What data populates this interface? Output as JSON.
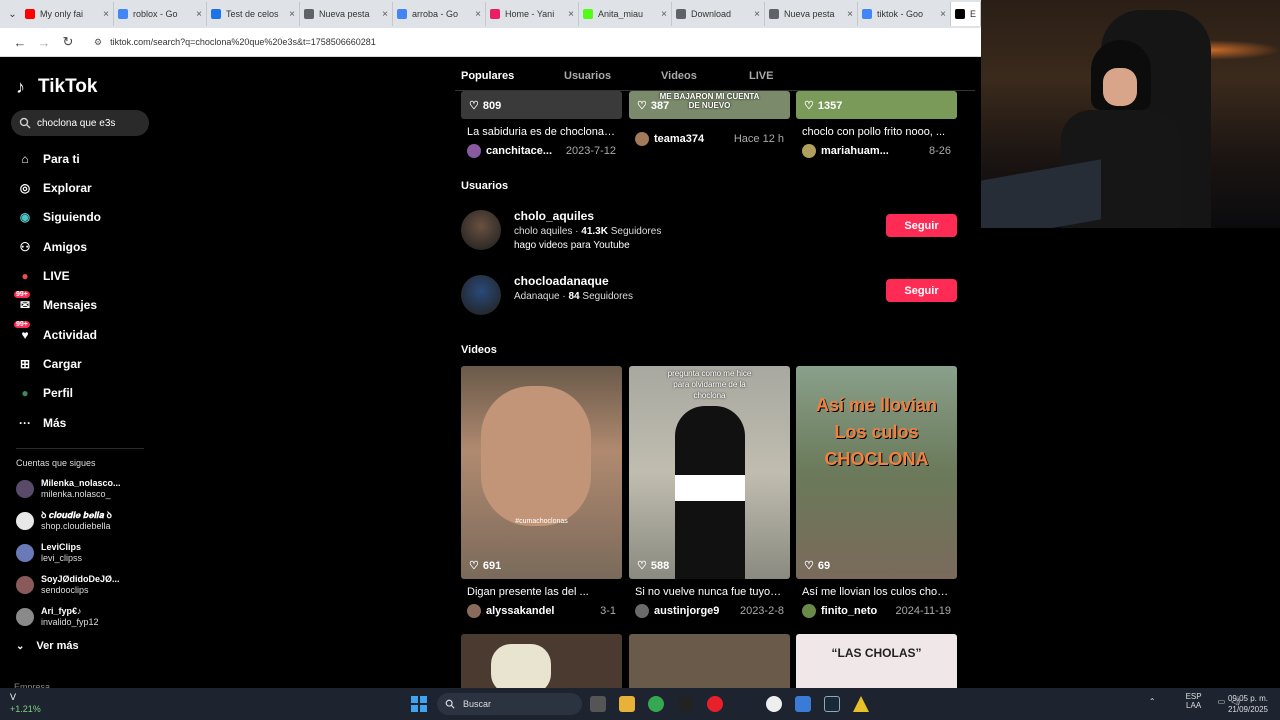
{
  "browser": {
    "tabs": [
      {
        "title": "My only fai",
        "color": "#ff0000"
      },
      {
        "title": "roblox - Go",
        "color": "#4285f4"
      },
      {
        "title": "Test de celos",
        "color": "#1a73e8"
      },
      {
        "title": "Nueva pesta",
        "color": "#5f6368"
      },
      {
        "title": "arroba - Go",
        "color": "#4285f4"
      },
      {
        "title": "Home - Yani",
        "color": "#e91e63"
      },
      {
        "title": "Anita_miau",
        "color": "#53fc18"
      },
      {
        "title": "Download",
        "color": "#5f6368"
      },
      {
        "title": "Nueva pesta",
        "color": "#5f6368"
      },
      {
        "title": "tiktok - Goo",
        "color": "#4285f4"
      },
      {
        "title": "En",
        "color": "#000000"
      }
    ],
    "url": "tiktok.com/search?q=choclona%20que%20e3s&t=1758506660281"
  },
  "sidebar": {
    "logo": "TikTok",
    "search_value": "choclona que e3s",
    "nav": [
      {
        "label": "Para ti",
        "icon": "home-icon"
      },
      {
        "label": "Explorar",
        "icon": "compass-icon"
      },
      {
        "label": "Siguiendo",
        "icon": "following-icon"
      },
      {
        "label": "Amigos",
        "icon": "friends-icon"
      },
      {
        "label": "LIVE",
        "icon": "live-icon"
      },
      {
        "label": "Mensajes",
        "icon": "messages-icon",
        "badge": "99+"
      },
      {
        "label": "Actividad",
        "icon": "activity-icon",
        "badge": "99+"
      },
      {
        "label": "Cargar",
        "icon": "upload-icon"
      },
      {
        "label": "Perfil",
        "icon": "profile-icon"
      },
      {
        "label": "Más",
        "icon": "more-icon"
      }
    ],
    "following_title": "Cuentas que sigues",
    "following": [
      {
        "name": "Milenka_nolasco...",
        "handle": "milenka.nolasco_",
        "color": "#5a4a6a"
      },
      {
        "name": "ꝺ 𝒄𝒍𝒐𝒖𝒅𝒊𝒆 𝒃𝒆𝒍𝒍𝒂 ꝺ",
        "handle": "shop.cloudiebella",
        "color": "#e8e8e8"
      },
      {
        "name": "LeviClips",
        "handle": "levi_clipss",
        "color": "#6a7ab8"
      },
      {
        "name": "SoyJØdidoDeJØ...",
        "handle": "sendooclips",
        "color": "#8a5a5a"
      },
      {
        "name": "Ari_fyp€♪",
        "handle": "invalido_fyp12",
        "color": "#8a8a8a"
      }
    ],
    "ver_mas": "Ver más",
    "truncated": "Empresa"
  },
  "main": {
    "tabs": [
      "Populares",
      "Usuarios",
      "Videos",
      "LIVE"
    ],
    "top_videos": [
      {
        "likes": "809",
        "desc": "La sabiduria es de choclonas...",
        "author": "canchitace...",
        "date": "2023-7-12",
        "thumb": "#3a3a3a",
        "av": "#8a5aa0"
      },
      {
        "likes": "387",
        "desc": "",
        "author": "teama374",
        "date": "Hace 12 h",
        "thumb": "#7a8a6a",
        "av": "#a07a5a",
        "overtext": "ME BAJARON MI CUENTA DE NUEVO"
      },
      {
        "likes": "1357",
        "desc": "choclo con pollo frito nooo, ...",
        "author": "mariahuam...",
        "date": "8-26",
        "thumb": "#7a9a5a",
        "av": "#b0a060"
      }
    ],
    "users_title": "Usuarios",
    "users": [
      {
        "name": "cholo_aquiles",
        "sub_name": "cholo aquiles",
        "followers": "41.3K",
        "followers_label": "Seguidores",
        "bio": "hago videos para Youtube",
        "button": "Seguir",
        "av": "#6a5040"
      },
      {
        "name": "chocloadanaque",
        "sub_name": "Adanaque",
        "followers": "84",
        "followers_label": "Seguidores",
        "bio": "",
        "button": "Seguir",
        "av": "#2a4a7a"
      }
    ],
    "videos_title": "Videos",
    "videos": [
      {
        "likes": "691",
        "desc": "Digan presente las del ...",
        "author": "alyssakandel",
        "date": "3-1",
        "av": "#8a6a5a",
        "caption": "#cumachoclonas",
        "overtext": ""
      },
      {
        "likes": "588",
        "desc": "Si no vuelve nunca fue tuyo! ...",
        "author": "austinjorge9",
        "date": "2023-2-8",
        "av": "#6a6a6a",
        "overtext": "pregunta como me hice para olvidarme de la choclona"
      },
      {
        "likes": "69",
        "desc": "Así me llovian los culos chocl...",
        "author": "finito_neto",
        "date": "2024-11-19",
        "av": "#6a8a4a",
        "overtext": "Así me llovian Los culos CHOCLONA"
      }
    ],
    "bottom_overtext": "“LAS CHOLAS”"
  },
  "taskbar": {
    "temp": "V",
    "change": "+1.21%",
    "search": "Buscar",
    "lang": "ESP",
    "lang2": "LAA",
    "time": "09:05 p. m.",
    "date": "21/09/2025"
  }
}
